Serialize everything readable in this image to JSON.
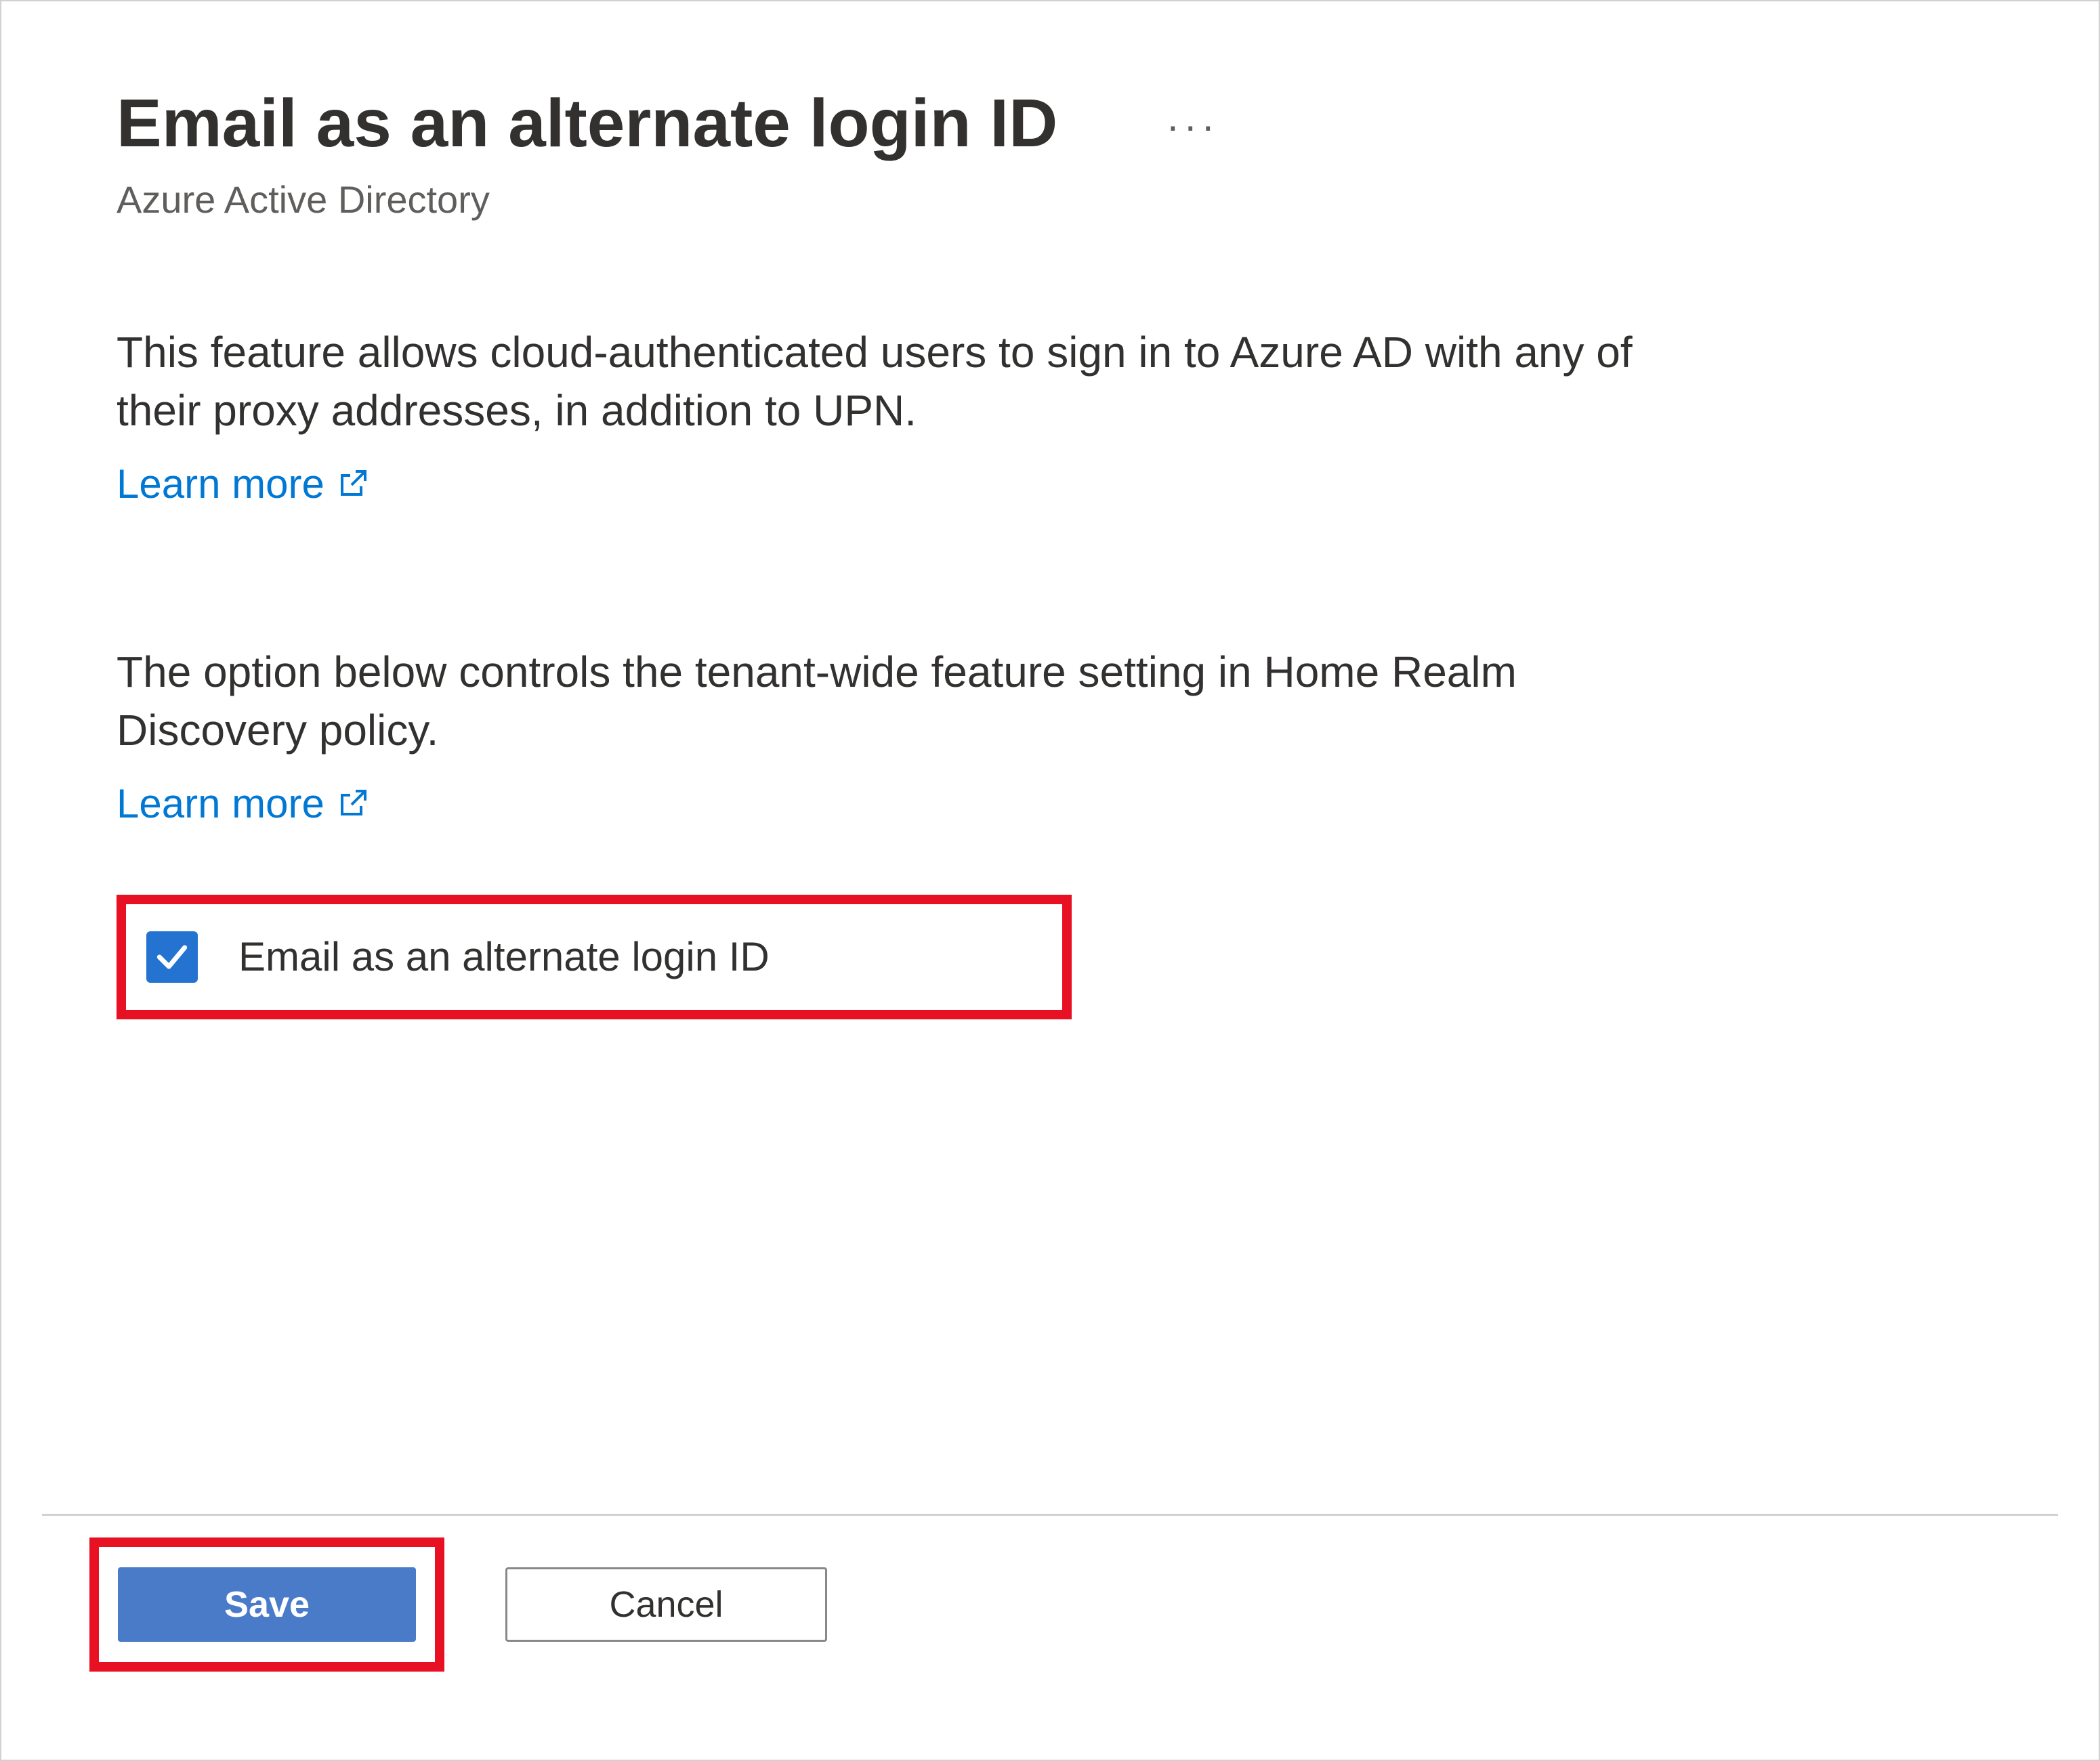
{
  "header": {
    "title": "Email as an alternate login ID",
    "subtitle": "Azure Active Directory"
  },
  "sections": {
    "feature_description": "This feature allows cloud-authenticated users to sign in to Azure AD with any of their proxy addresses, in addition to UPN.",
    "feature_learn_more": "Learn more",
    "policy_description": "The option below controls the tenant-wide feature setting in Home Realm Discovery policy.",
    "policy_learn_more": "Learn more"
  },
  "checkbox": {
    "label": "Email as an alternate login ID",
    "checked": true
  },
  "buttons": {
    "save": "Save",
    "cancel": "Cancel"
  },
  "colors": {
    "link": "#0078d4",
    "primary_button": "#4a7bc8",
    "highlight_border": "#e81123",
    "checkbox_bg": "#2573d1"
  }
}
